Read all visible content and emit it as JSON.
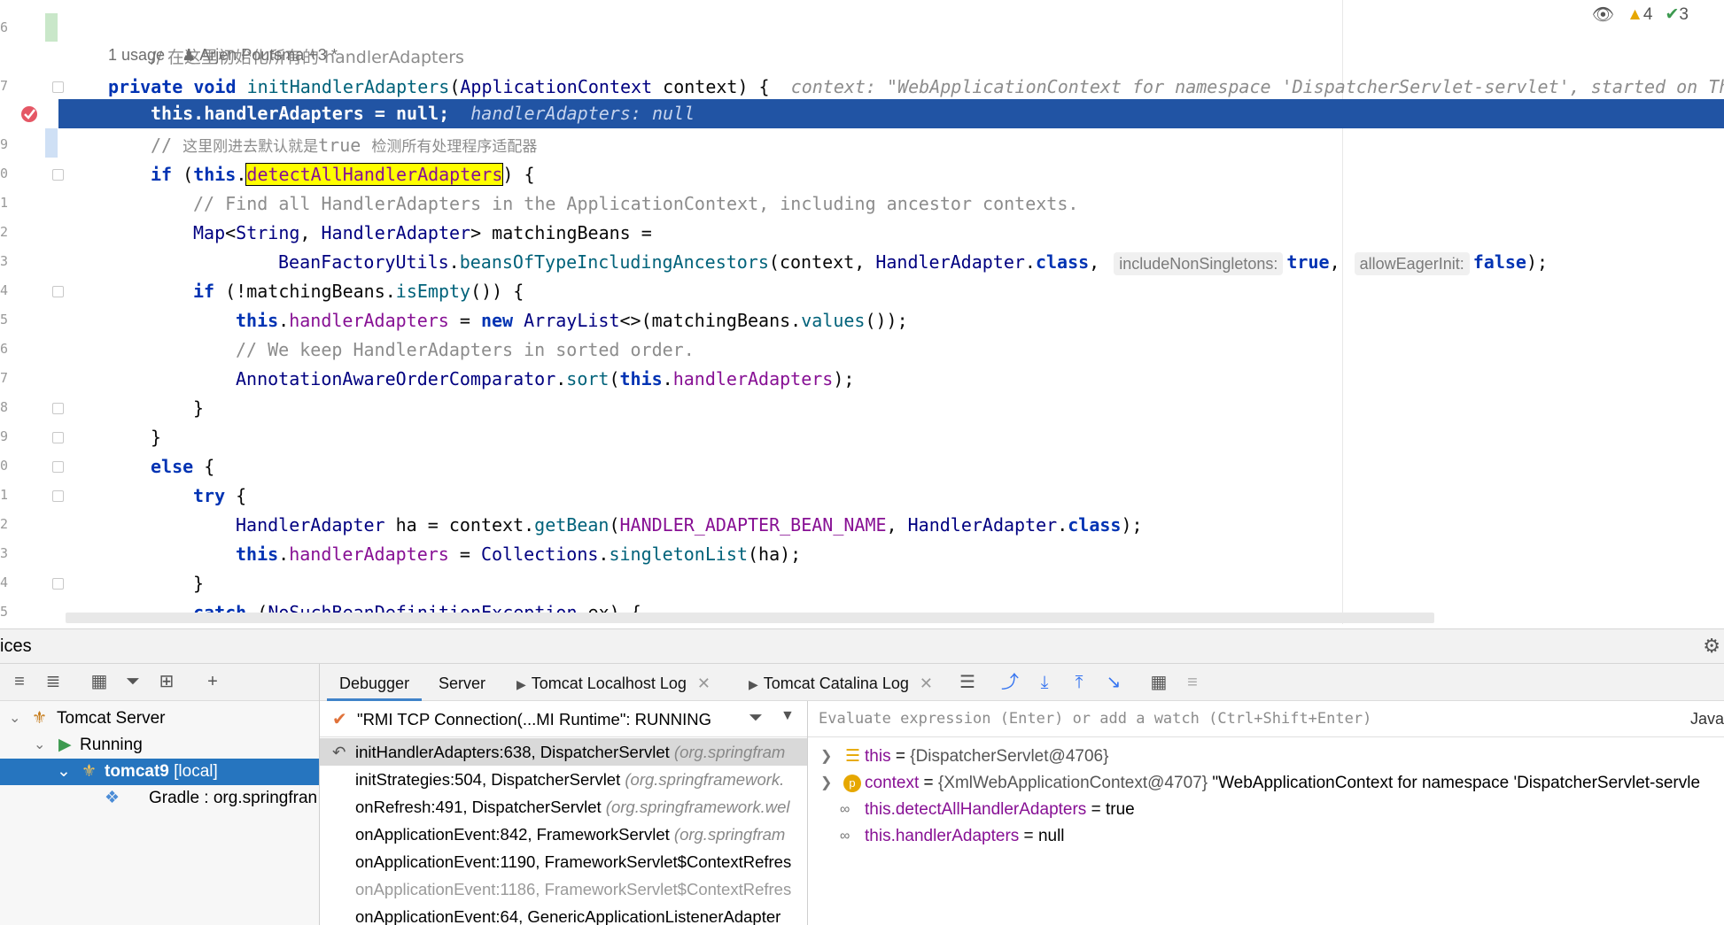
{
  "editor": {
    "gutter_numbers": [
      "6",
      "7",
      "8",
      "9",
      "0",
      "1",
      "2",
      "3",
      "4",
      "5",
      "6",
      "7",
      "8",
      "9",
      "0",
      "1",
      "2",
      "3",
      "4",
      "5"
    ],
    "comment_header": "// 在这里初始化所有的 handlerAdapters",
    "usage": "1 usage",
    "author": "Arjen Poutsma +3 *",
    "inspection_warnings": "4",
    "inspection_ok": "3",
    "lines": {
      "l1_private": "private",
      "l1_void": "void",
      "l1_method": "initHandlerAdapters",
      "l1_open": "(",
      "l1_type": "ApplicationContext",
      "l1_rest": " context) {",
      "l1_hint": "context: \"WebApplicationContext for namespace 'DispatcherServlet-servlet', started on Th",
      "l2_this": "this",
      "l2_mid": ".handlerAdapters = ",
      "l2_null": "null",
      "l2_end": ";",
      "l2_hint": "handlerAdapters: null",
      "l3_comment_a": "// ",
      "l3_comment_cn1": "这里刚进去默认就是",
      "l3_comment_b": "true ",
      "l3_comment_cn2": "检测所有处理程序适配器",
      "l4_if": "if",
      "l4_open": " (",
      "l4_this": "this",
      "l4_dot": ".",
      "l4_field": "detectAllHandlerAdapters",
      "l4_close": ") {",
      "l5_comment": "// Find all HandlerAdapters in the ApplicationContext, including ancestor contexts.",
      "l6_map": "Map",
      "l6_lt": "<",
      "l6_string": "String",
      "l6_comma": ", ",
      "l6_ha": "HandlerAdapter",
      "l6_rest": "> matchingBeans =",
      "l7_bfu": "BeanFactoryUtils",
      "l7_dot": ".",
      "l7_method": "beansOfTypeIncludingAncestors",
      "l7_args": "(context, ",
      "l7_ha": "HandlerAdapter",
      "l7_dot2": ".",
      "l7_class": "class",
      "l7_comma": ",",
      "l7_inlay1": "includeNonSingletons:",
      "l7_true": "true",
      "l7_comma2": ",",
      "l7_inlay2": "allowEagerInit:",
      "l7_false": "false",
      "l7_end": ");",
      "l8_if": "if",
      "l8_open": " (!matchingBeans.",
      "l8_method": "isEmpty",
      "l8_close": "()) {",
      "l9_this": "this",
      "l9_dot": ".",
      "l9_field": "handlerAdapters",
      "l9_eq": " = ",
      "l9_new": "new",
      "l9_sp": " ",
      "l9_type": "ArrayList",
      "l9_args": "<>(matchingBeans.",
      "l9_values": "values",
      "l9_end": "());",
      "l10_comment": "// We keep HandlerAdapters in sorted order.",
      "l11_type": "AnnotationAwareOrderComparator",
      "l11_dot": ".",
      "l11_method": "sort",
      "l11_open": "(",
      "l11_this": "this",
      "l11_dot2": ".",
      "l11_field": "handlerAdapters",
      "l11_end": ");",
      "l12": "}",
      "l13": "}",
      "l14_else": "else",
      "l14_brace": " {",
      "l15_try": "try",
      "l15_brace": " {",
      "l16_type": "HandlerAdapter",
      "l16_mid": " ha = context.",
      "l16_method": "getBean",
      "l16_open": "(",
      "l16_const": "HANDLER_ADAPTER_BEAN_NAME",
      "l16_comma": ", ",
      "l16_ha": "HandlerAdapter",
      "l16_dot": ".",
      "l16_class": "class",
      "l16_end": ");",
      "l17_this": "this",
      "l17_dot": ".",
      "l17_field": "handlerAdapters",
      "l17_eq": " = ",
      "l17_coll": "Collections",
      "l17_dot2": ".",
      "l17_method": "singletonList",
      "l17_end": "(ha);",
      "l18": "}",
      "l19_catch": "catch",
      "l19_open": " (",
      "l19_type": "NoSuchBeanDefinitionException",
      "l19_end": " ex) {"
    }
  },
  "services": {
    "title": "ices",
    "tree": {
      "server": "Tomcat Server",
      "running": "Running",
      "tomcat": "tomcat9",
      "tomcat_suffix": " [local]",
      "gradle": "Gradle : org.springfran"
    }
  },
  "tabs": {
    "debugger": "Debugger",
    "server": "Server",
    "localhost_log": "Tomcat Localhost Log",
    "catalina_log": "Tomcat Catalina Log"
  },
  "frames": {
    "thread": "\"RMI TCP Connection(...MI Runtime\": RUNNING",
    "items": [
      {
        "method": "initHandlerAdapters:638, DispatcherServlet ",
        "pkg": "(org.springfram"
      },
      {
        "method": "initStrategies:504, DispatcherServlet ",
        "pkg": "(org.springframework."
      },
      {
        "method": "onRefresh:491, DispatcherServlet ",
        "pkg": "(org.springframework.wel"
      },
      {
        "method": "onApplicationEvent:842, FrameworkServlet ",
        "pkg": "(org.springfram"
      },
      {
        "method": "onApplicationEvent:1190, FrameworkServlet$ContextRefres",
        "pkg": ""
      },
      {
        "method": "onApplicationEvent:1186, FrameworkServlet$ContextRefres",
        "pkg": ""
      },
      {
        "method": "onApplicationEvent:64, GenericApplicationListenerAdapter",
        "pkg": ""
      }
    ]
  },
  "variables": {
    "eval_placeholder": "Evaluate expression (Enter) or add a watch (Ctrl+Shift+Enter)",
    "lang": "Java",
    "items": [
      {
        "name": "this",
        "eq": " = ",
        "value": "{DispatcherServlet@4706}",
        "extra": ""
      },
      {
        "name": "context",
        "eq": " = ",
        "value": "{XmlWebApplicationContext@4707}",
        "extra": " \"WebApplicationContext for namespace 'DispatcherServlet-servle"
      },
      {
        "name": "this.detectAllHandlerAdapters",
        "eq": " = ",
        "value": "true",
        "extra": ""
      },
      {
        "name": "this.handlerAdapters",
        "eq": " = ",
        "value": "null",
        "extra": ""
      }
    ]
  },
  "colors": {
    "exec_line": "#2154a4",
    "selection": "#2675bf",
    "keyword": "#0033b3",
    "field": "#871094",
    "method": "#00627a"
  }
}
